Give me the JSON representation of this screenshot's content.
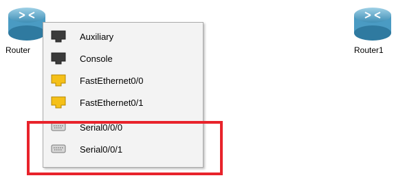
{
  "devices": [
    {
      "label": "Router",
      "icon": "router-icon"
    },
    {
      "label": "Router1",
      "icon": "router-icon"
    }
  ],
  "port_menu": {
    "items": [
      {
        "label": "Auxiliary",
        "icon": "console-port-icon",
        "color": "#3a3a3a"
      },
      {
        "label": "Console",
        "icon": "console-port-icon",
        "color": "#3a3a3a"
      },
      {
        "label": "FastEthernet0/0",
        "icon": "ethernet-port-icon",
        "color": "#f5c018"
      },
      {
        "label": "FastEthernet0/1",
        "icon": "ethernet-port-icon",
        "color": "#f5c018"
      },
      {
        "label": "Serial0/0/0",
        "icon": "serial-port-icon",
        "color": "#c8c8c8"
      },
      {
        "label": "Serial0/0/1",
        "icon": "serial-port-icon",
        "color": "#c8c8c8"
      }
    ]
  },
  "highlight": {
    "color": "#e8232b"
  }
}
